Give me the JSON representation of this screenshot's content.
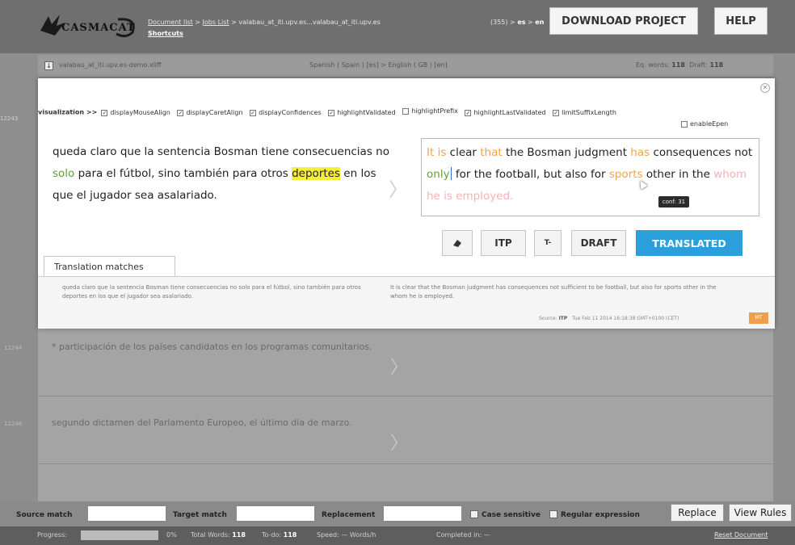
{
  "header": {
    "logo_text": "CASMACAT",
    "breadcrumb": {
      "document_list": "Document list",
      "jobs_list": "Jobs List",
      "job": "valabau_at_iti.upv.es...valabau_at_iti.upv.es",
      "shortcuts": "Shortcuts"
    },
    "segment_count": "(355)",
    "src_lang": "es",
    "tgt_lang": "en",
    "download_label": "DOWNLOAD PROJECT",
    "help_label": "HELP"
  },
  "docstrip": {
    "file_name": "valabau_at_iti.upv.es-demo.xliff",
    "lang_pair": "Spanish ( Spain ) [es] > English ( GB ) [en]",
    "eq_words_label": "Eq. words:",
    "eq_words": "118",
    "draft_label": "Draft:",
    "draft": "118"
  },
  "segments": [
    {
      "id": "12244",
      "text": "* participación de los países candidatos en los programas comunitarios."
    },
    {
      "id": "12246",
      "text": "segundo dictamen del Parlamento Europeo, el último día de marzo."
    }
  ],
  "editor": {
    "segment_id": "12243",
    "visualization_label": "visualization >>",
    "options": [
      {
        "label": "displayMouseAlign",
        "checked": true
      },
      {
        "label": "displayCaretAlign",
        "checked": true
      },
      {
        "label": "displayConfidences",
        "checked": true
      },
      {
        "label": "highlightValidated",
        "checked": true
      },
      {
        "label": "highlightPrefix",
        "checked": false
      },
      {
        "label": "highlightLastValidated",
        "checked": true
      },
      {
        "label": "limitSuffixLength",
        "checked": true
      }
    ],
    "enable_epen": {
      "label": "enableEpen",
      "checked": false
    },
    "source": {
      "part1": "queda claro que la sentencia Bosman tiene consecuencias no ",
      "solo": "solo",
      "part2": " para el fútbol, sino también para otros ",
      "deportes": "deportes",
      "part3": " en los que el jugador sea asalariado."
    },
    "target": {
      "it_is": "It is",
      "clear": " clear ",
      "that": "that",
      "bosman": " the Bosman judgment ",
      "has": "has",
      "consequences": " consequences not ",
      "only": "only",
      "for_the": " for the football, but also for ",
      "sports": "sports",
      "other": " other in the ",
      "whom": "whom",
      "employed": " he is employed."
    },
    "conf_tooltip": "conf: 31",
    "buttons": {
      "itp": "ITP",
      "t": "T-",
      "draft": "DRAFT",
      "translated": "TRANSLATED"
    }
  },
  "matches": {
    "tab_label": "Translation matches",
    "source": "queda claro que la sentencia Bosman tiene consecuencias no solo para el fútbol, sino también para otros deportes en los que el jugador sea asalariado.",
    "target": "It is clear that the Bosman judgment has consequences not sufficient to be football, but also for sports other in the whom he is employed.",
    "source_label": "Source:",
    "source_value": "ITP",
    "date": "Tue Feb 11 2014 16:18:38 GMT+0100 (CET)",
    "percent": "MT"
  },
  "findbar": {
    "source_match": "Source match",
    "target_match": "Target match",
    "replacement": "Replacement",
    "case_sensitive": "Case sensitive",
    "regular_expression": "Regular expression",
    "replace_btn": "Replace",
    "view_rules_btn": "View Rules"
  },
  "status": {
    "progress_label": "Progress:",
    "progress_value": 0,
    "progress_pct": "0%",
    "total_words_label": "Total Words:",
    "total_words": "118",
    "todo_label": "To-do:",
    "todo": "118",
    "speed_label": "Speed:",
    "speed": "— Words/h",
    "completed_label": "Completed in:",
    "completed": "—",
    "reset": "Reset Document"
  }
}
